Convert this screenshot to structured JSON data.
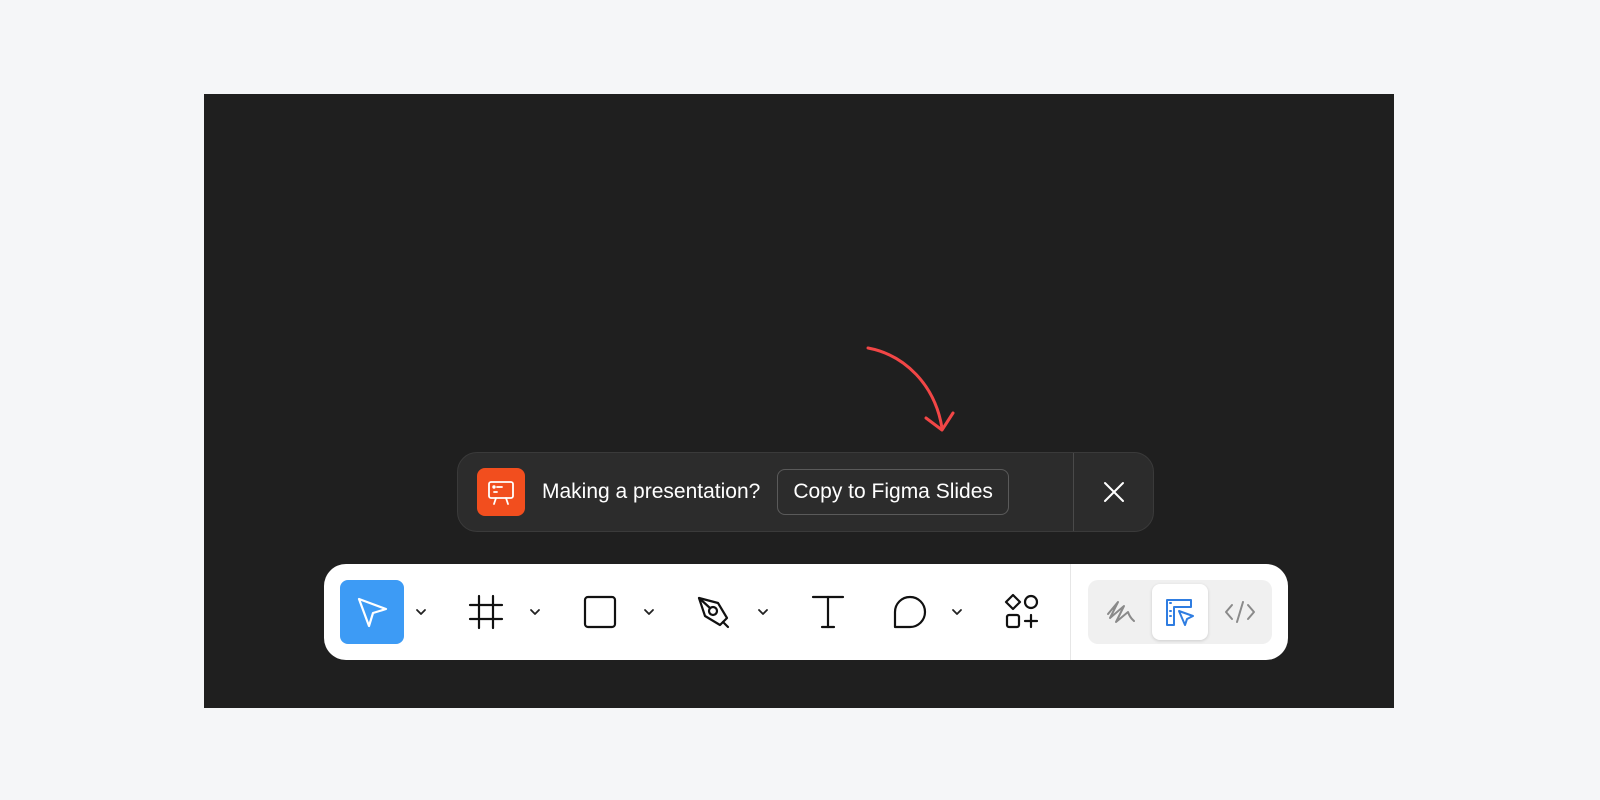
{
  "banner": {
    "message": "Making a presentation?",
    "cta_label": "Copy to Figma Slides",
    "icon": "presentation-icon",
    "close_icon": "close-icon"
  },
  "toolbar": {
    "tools": [
      {
        "name": "move",
        "icon": "move-cursor-icon",
        "active": true,
        "has_menu": true
      },
      {
        "name": "frame",
        "icon": "frame-icon",
        "active": false,
        "has_menu": true
      },
      {
        "name": "shape",
        "icon": "rectangle-icon",
        "active": false,
        "has_menu": true
      },
      {
        "name": "pen",
        "icon": "pen-icon",
        "active": false,
        "has_menu": true
      },
      {
        "name": "text",
        "icon": "text-icon",
        "active": false,
        "has_menu": false
      },
      {
        "name": "comment",
        "icon": "comment-icon",
        "active": false,
        "has_menu": true
      },
      {
        "name": "actions",
        "icon": "actions-icon",
        "active": false,
        "has_menu": false
      }
    ],
    "modes": [
      {
        "name": "draw",
        "icon": "draw-icon",
        "active": false
      },
      {
        "name": "design",
        "icon": "design-mode-icon",
        "active": true
      },
      {
        "name": "dev",
        "icon": "code-icon",
        "active": false
      }
    ]
  },
  "colors": {
    "canvas": "#1f1f1f",
    "accent": "#3d9bf5",
    "banner_icon_bg": "#f24e1e",
    "annotation_arrow": "#f24646",
    "design_mode": "#2f7de1"
  }
}
